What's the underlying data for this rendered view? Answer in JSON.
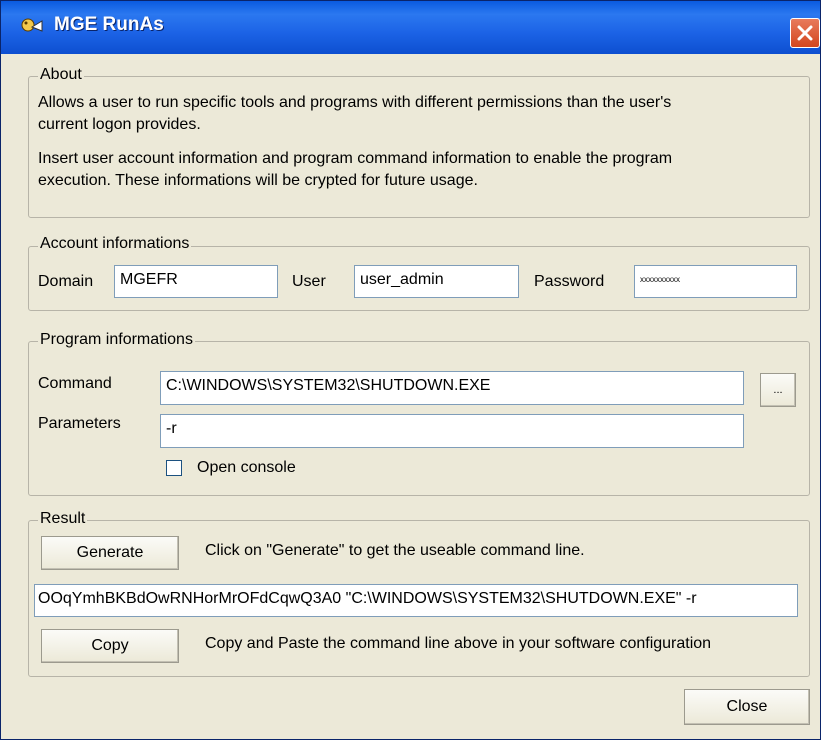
{
  "window": {
    "title": "MGE RunAs",
    "close_icon": "close-icon",
    "app_icon": "app-icon"
  },
  "about": {
    "legend": "About",
    "line1a": "Allows a user to run specific tools and programs with different permissions than the user's",
    "line1b": "current logon provides.",
    "line2a": "Insert user account information and program command information to enable the program",
    "line2b": "execution. These informations will be crypted for future usage."
  },
  "account": {
    "legend": "Account informations",
    "domain_label": "Domain",
    "domain_value": "MGEFR",
    "user_label": "User",
    "user_value": "user_admin",
    "password_label": "Password",
    "password_value": "xxxxxxxxxx"
  },
  "program": {
    "legend": "Program informations",
    "command_label": "Command",
    "command_value": "C:\\WINDOWS\\SYSTEM32\\SHUTDOWN.EXE",
    "browse_label": "...",
    "parameters_label": "Parameters",
    "parameters_value": "-r",
    "open_console_label": "Open console",
    "open_console_checked": false
  },
  "result": {
    "legend": "Result",
    "generate_label": "Generate",
    "generate_hint": "Click on \"Generate\" to get the useable command line.",
    "command_line_value": "OOqYmhBKBdOwRNHorMrOFdCqwQ3A0 \"C:\\WINDOWS\\SYSTEM32\\SHUTDOWN.EXE\" -r",
    "copy_label": "Copy",
    "copy_hint": "Copy and Paste the command line above in your software configuration"
  },
  "footer": {
    "close_label": "Close"
  }
}
